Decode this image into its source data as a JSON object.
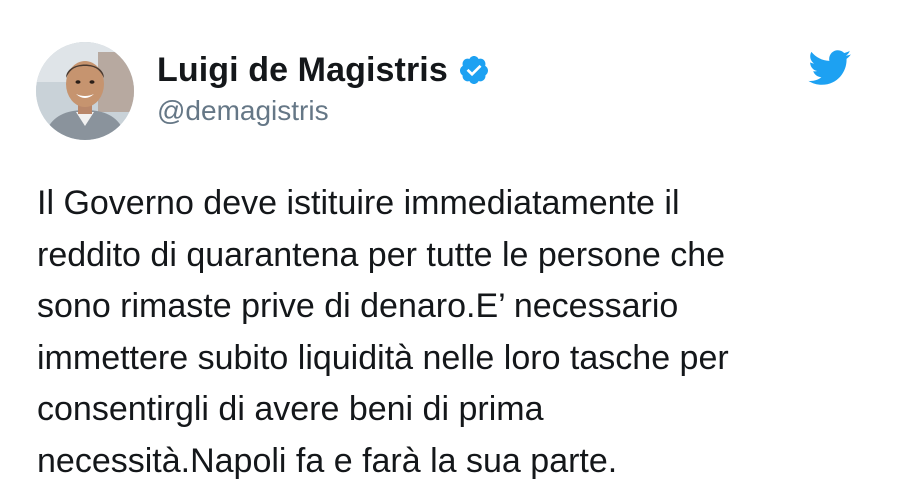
{
  "tweet": {
    "author": {
      "display_name": "Luigi de Magistris",
      "handle": "@demagistris",
      "verified": true
    },
    "text_lines": [
      "Il Governo deve istituire immediatamente il",
      "reddito di quarantena per tutte le persone che",
      "sono rimaste prive di denaro.E’ necessario",
      "immettere subito liquidità nelle loro tasche per",
      "consentirgli di avere beni di prima",
      "necessità.Napoli fa e farà la sua parte."
    ]
  },
  "icons": {
    "verified": "verified-badge-icon",
    "brand": "twitter-bird-icon"
  },
  "colors": {
    "twitter_blue": "#1da1f2",
    "text_primary": "#14171a",
    "text_secondary": "#657786",
    "background": "#ffffff"
  }
}
